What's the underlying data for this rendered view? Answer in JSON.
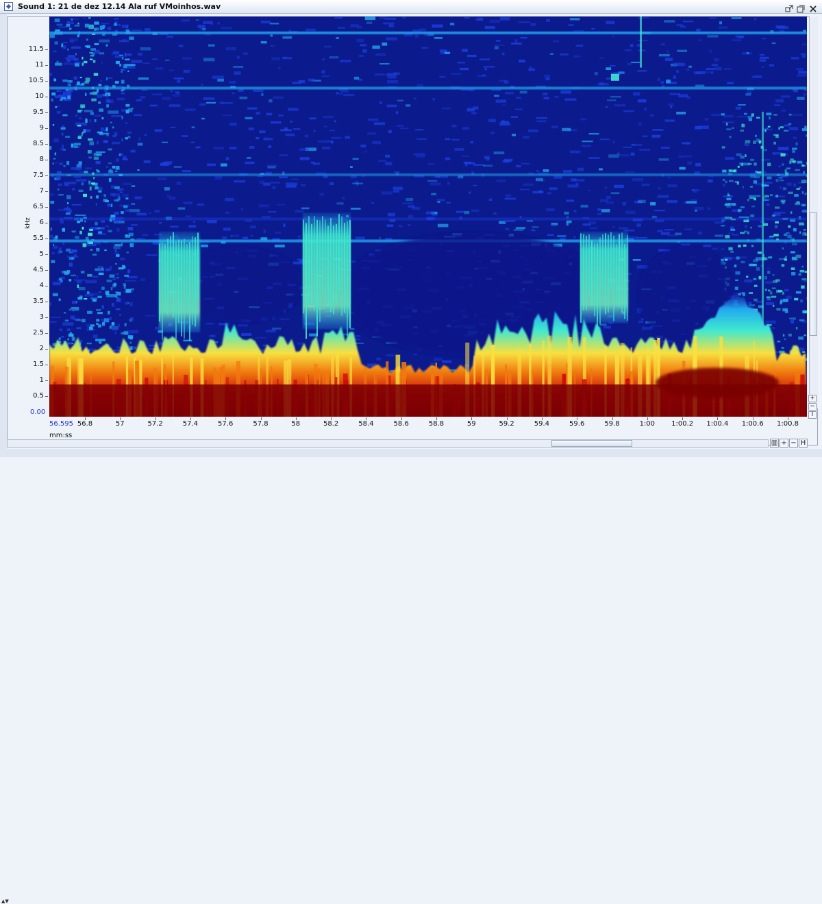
{
  "window": {
    "title": "Sound 1: 21 de dez 12.14 Ala ruf VMoinhos.wav",
    "icon": "sound-file-icon",
    "controls": [
      "undock-icon",
      "restore-icon",
      "close-icon"
    ]
  },
  "spectrogram": {
    "y_unit": "kHz",
    "y_min_label": "0.00",
    "y_ticks": [
      "0.5",
      "1",
      "1.5",
      "2",
      "2.5",
      "3",
      "3.5",
      "4",
      "4.5",
      "5",
      "5.5",
      "6",
      "6.5",
      "7",
      "7.5",
      "8",
      "8.5",
      "9",
      "9.5",
      "10",
      "10.5",
      "11",
      "11.5"
    ],
    "x_unit": "mm:ss",
    "x_start_label": "56.595",
    "x_ticks": [
      "56.8",
      "57",
      "57.2",
      "57.4",
      "57.6",
      "57.8",
      "58",
      "58.2",
      "58.4",
      "58.6",
      "58.8",
      "59",
      "59.2",
      "59.4",
      "59.6",
      "59.8",
      "1:00",
      "1:00.2",
      "1:00.4",
      "1:00.6",
      "1:00.8"
    ],
    "colormap": [
      "#0b1a8c",
      "#1c3fe0",
      "#22a8f0",
      "#3fe8d0",
      "#f8e040",
      "#f07a10",
      "#cc1008",
      "#7a0004"
    ]
  },
  "scrollbars": {
    "vertical_position": 0.73,
    "horizontal_position": 0.8
  },
  "zoom_controls": {
    "vertical": [
      "+",
      "−",
      "I"
    ],
    "horizontal": [
      "+",
      "−",
      "H"
    ]
  }
}
